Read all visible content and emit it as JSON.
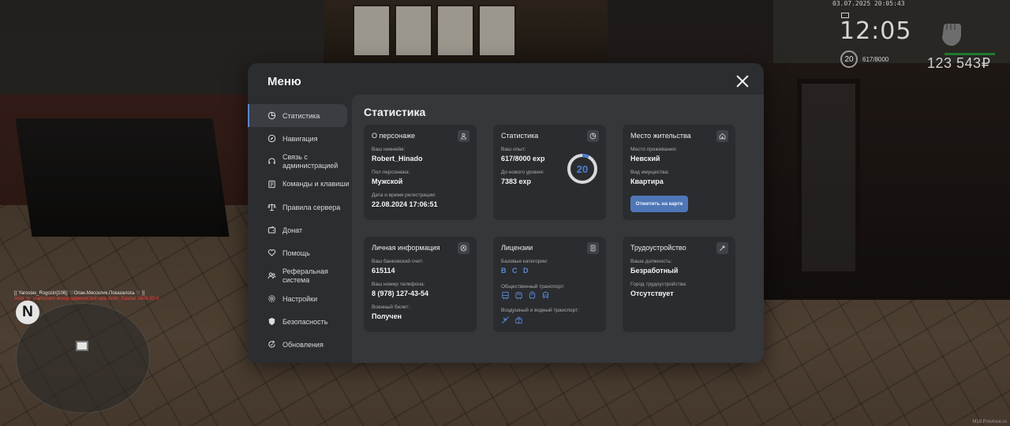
{
  "hud": {
    "datetime": "03.07.2025 20:05:43",
    "time": "12:05",
    "level": "20",
    "exp": "617/8000",
    "money": "123 543₽",
    "chat_line1": "[( Yaroslav_Rogozin[106]: ♡Опан.Мессклик.Показалось ♡ )]",
    "chat_line2": "Aridi_ry_Markooam игнор администратора Ardio_Eavitar 1606 30 л",
    "compass": "N",
    "watermark": "M18.Province.ru"
  },
  "menu": {
    "title": "Меню",
    "sidebar": [
      {
        "label": "Статистика",
        "icon": "chart-pie-icon"
      },
      {
        "label": "Навигация",
        "icon": "compass-icon"
      },
      {
        "label": "Связь с администрацией",
        "icon": "headset-icon"
      },
      {
        "label": "Команды и клавиши",
        "icon": "keyboard-icon"
      },
      {
        "label": "Правила сервера",
        "icon": "scales-icon"
      },
      {
        "label": "Донат",
        "icon": "wallet-icon"
      },
      {
        "label": "Помощь",
        "icon": "heart-hand-icon"
      },
      {
        "label": "Реферальная система",
        "icon": "people-icon"
      },
      {
        "label": "Настройки",
        "icon": "gear-icon"
      },
      {
        "label": "Безопасность",
        "icon": "shield-icon"
      },
      {
        "label": "Обновления",
        "icon": "refresh-icon"
      }
    ]
  },
  "stats": {
    "title": "Статистика",
    "character": {
      "title": "О персонаже",
      "nick_label": "Ваш никнейм:",
      "nick": "Robert_Hinado",
      "gender_label": "Пол персонажа:",
      "gender": "Мужской",
      "reg_label": "Дата и время регистрации:",
      "reg": "22.08.2024 17:06:51"
    },
    "statistics": {
      "title": "Статистика",
      "exp_label": "Ваш опыт:",
      "exp": "617/8000 exp",
      "next_label": "До нового уровня:",
      "next": "7383 exp",
      "level": "20",
      "level_progress": 0.077
    },
    "residence": {
      "title": "Место жительства",
      "place_label": "Место проживания:",
      "place": "Невский",
      "property_label": "Вид имущества:",
      "property": "Квартира",
      "map_button": "Отметить на карте"
    },
    "personal": {
      "title": "Личная информация",
      "bank_label": "Ваш банковский счет:",
      "bank": "615114",
      "phone_label": "Ваш номер телефона:",
      "phone": "8 (978) 127-43-54",
      "military_label": "Военный билет:",
      "military": "Получен"
    },
    "licenses": {
      "title": "Лицензии",
      "base_label": "Базовые категории:",
      "categories": [
        "B",
        "C",
        "D"
      ],
      "public_label": "Общественный транспорт:",
      "air_label": "Воздушный и водный транспорт:"
    },
    "employment": {
      "title": "Трудоустройство",
      "position_label": "Ваша должность:",
      "position": "Безработный",
      "city_label": "Город трудоустройства:",
      "city": "Отсутствует"
    }
  },
  "colors": {
    "accent": "#4f77b8",
    "ring": "#4f7fcf",
    "panel": "#2b2d30",
    "content": "#35373a",
    "card": "#2a2c2f"
  }
}
